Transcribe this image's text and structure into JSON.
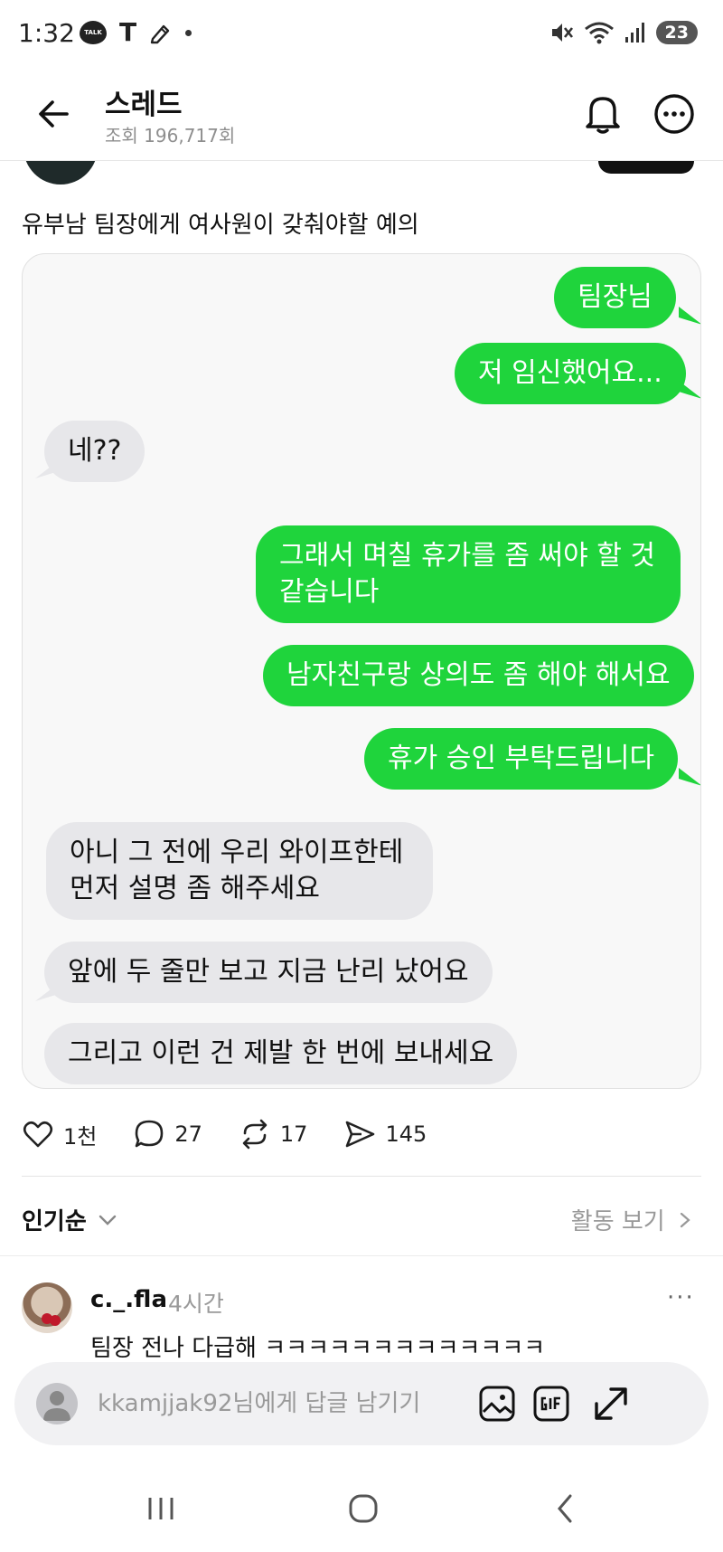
{
  "status_bar": {
    "time": "1:32",
    "talk_icon_text": "TALK",
    "t_icon": "T",
    "battery": "23",
    "icons": [
      "talk-icon",
      "t-icon",
      "pen-icon",
      "dot-icon",
      "mute-icon",
      "wifi-icon",
      "signal-icon",
      "battery-icon"
    ]
  },
  "header": {
    "title": "스레드",
    "subtitle": "조회 196,717회"
  },
  "post": {
    "text": "유부남 팀장에게 여사원이 갖춰야할 예의",
    "chat": {
      "m1": "팀장님",
      "m2": "저 임신했어요...",
      "m3": "네??",
      "m4_line1": "그래서 며칠 휴가를 좀 써야 할 것",
      "m4_line2": "같습니다",
      "m5": "남자친구랑 상의도 좀 해야 해서요",
      "m6": "휴가 승인 부탁드립니다",
      "m7_line1": "아니 그 전에 우리 와이프한테",
      "m7_line2": "먼저 설명 좀 해주세요",
      "m8": "앞에 두 줄만 보고 지금 난리 났어요",
      "m9": "그리고 이런 건 제발 한 번에 보내세요"
    },
    "colors": {
      "sent_bubble": "#1fd43c",
      "received_bubble": "#e7e7ea"
    }
  },
  "actions": {
    "likes": "1천",
    "comments": "27",
    "reposts": "17",
    "shares": "145"
  },
  "sort": {
    "label": "인기순",
    "activity_link": "활동 보기"
  },
  "comment": {
    "username": "c._.fla",
    "time": "4시간",
    "more": "···",
    "text": "팀장 전나 다급해 ㅋㅋㅋㅋㅋㅋㅋㅋㅋㅋㅋㅋㅋ"
  },
  "reply": {
    "placeholder": "kkamjjak92님에게 답글 남기기"
  }
}
